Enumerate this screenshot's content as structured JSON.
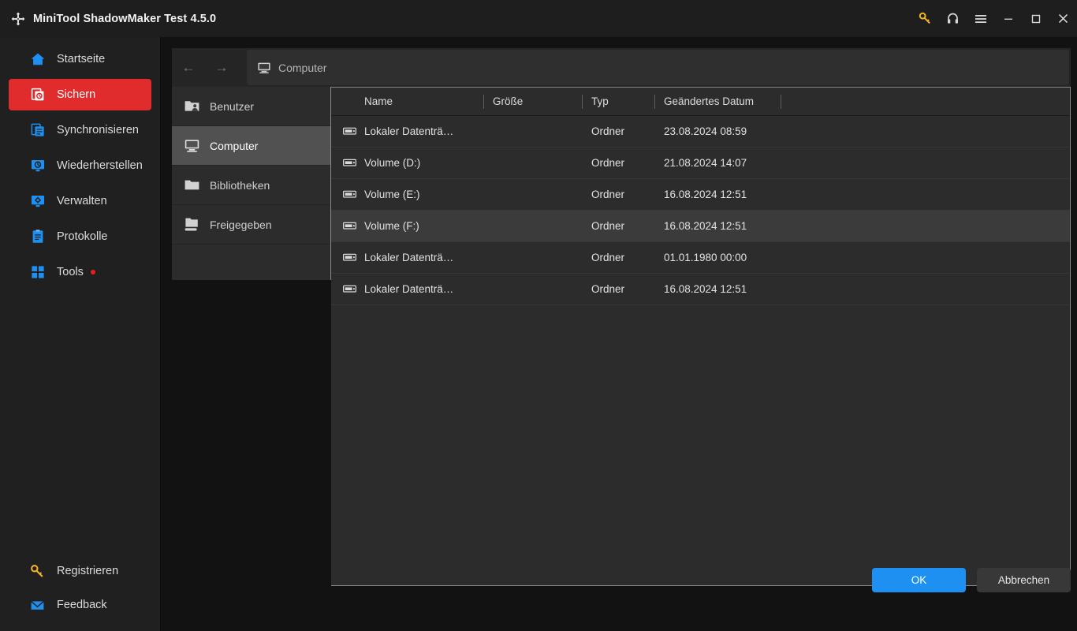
{
  "window": {
    "title": "MiniTool ShadowMaker Test 4.5.0",
    "logo_icon": "shadowmaker-logo-icon",
    "controls": [
      {
        "name": "register-key-icon",
        "label": ""
      },
      {
        "name": "support-headset-icon",
        "label": ""
      },
      {
        "name": "menu-hamburger-icon",
        "label": ""
      },
      {
        "name": "minimize-icon",
        "label": ""
      },
      {
        "name": "maximize-icon",
        "label": ""
      },
      {
        "name": "close-icon",
        "label": ""
      }
    ]
  },
  "sidebar": {
    "items": [
      {
        "label": "Startseite",
        "icon": "home-icon",
        "active": false,
        "badge": false
      },
      {
        "label": "Sichern",
        "icon": "backup-icon",
        "active": true,
        "badge": false
      },
      {
        "label": "Synchronisieren",
        "icon": "sync-icon",
        "active": false,
        "badge": false
      },
      {
        "label": "Wiederherstellen",
        "icon": "restore-icon",
        "active": false,
        "badge": false
      },
      {
        "label": "Verwalten",
        "icon": "manage-icon",
        "active": false,
        "badge": false
      },
      {
        "label": "Protokolle",
        "icon": "logs-icon",
        "active": false,
        "badge": false
      },
      {
        "label": "Tools",
        "icon": "tools-icon",
        "active": false,
        "badge": true
      }
    ],
    "bottom_items": [
      {
        "label": "Registrieren",
        "icon": "key-icon"
      },
      {
        "label": "Feedback",
        "icon": "mail-icon"
      }
    ],
    "accent_color": "#e02c2c",
    "badge_color": "#e62020"
  },
  "navbar": {
    "back_icon": "arrow-left-icon",
    "forward_icon": "arrow-right-icon",
    "address": {
      "icon": "computer-icon",
      "value": "Computer",
      "placeholder": "Computer"
    }
  },
  "tree": {
    "items": [
      {
        "label": "Benutzer",
        "icon": "users-folder-icon",
        "selected": false
      },
      {
        "label": "Computer",
        "icon": "computer-icon",
        "selected": true
      },
      {
        "label": "Bibliotheken",
        "icon": "folder-icon",
        "selected": false
      },
      {
        "label": "Freigegeben",
        "icon": "shared-folder-icon",
        "selected": false
      }
    ]
  },
  "file_list": {
    "columns": [
      {
        "key": "name",
        "label": "Name"
      },
      {
        "key": "size",
        "label": "Größe"
      },
      {
        "key": "type",
        "label": "Typ"
      },
      {
        "key": "date",
        "label": "Geändertes Datum"
      }
    ],
    "rows": [
      {
        "icon": "drive-icon",
        "name": "Lokaler Datenträ…",
        "size": "",
        "type": "Ordner",
        "date": "23.08.2024 08:59",
        "selected": false
      },
      {
        "icon": "drive-icon",
        "name": "Volume (D:)",
        "size": "",
        "type": "Ordner",
        "date": "21.08.2024 14:07",
        "selected": false
      },
      {
        "icon": "drive-icon",
        "name": "Volume (E:)",
        "size": "",
        "type": "Ordner",
        "date": "16.08.2024 12:51",
        "selected": false
      },
      {
        "icon": "drive-icon",
        "name": "Volume (F:)",
        "size": "",
        "type": "Ordner",
        "date": "16.08.2024 12:51",
        "selected": true
      },
      {
        "icon": "drive-icon",
        "name": "Lokaler Datenträ…",
        "size": "",
        "type": "Ordner",
        "date": "01.01.1980 00:00",
        "selected": false
      },
      {
        "icon": "drive-icon",
        "name": "Lokaler Datenträ…",
        "size": "",
        "type": "Ordner",
        "date": "16.08.2024 12:51",
        "selected": false
      }
    ]
  },
  "footer": {
    "ok_label": "OK",
    "cancel_label": "Abbrechen",
    "ok_color": "#1e90f2"
  }
}
